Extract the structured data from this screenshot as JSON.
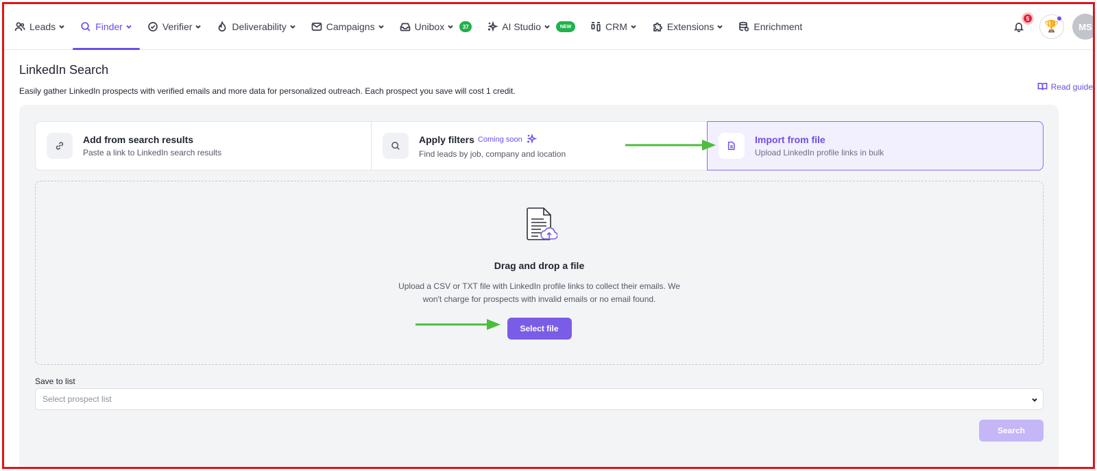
{
  "nav": {
    "items": [
      {
        "label": "Leads",
        "icon": "users-icon",
        "dropdown": true,
        "active": false
      },
      {
        "label": "Finder",
        "icon": "search-icon",
        "dropdown": true,
        "active": true
      },
      {
        "label": "Verifier",
        "icon": "check-circle-icon",
        "dropdown": true,
        "active": false
      },
      {
        "label": "Deliverability",
        "icon": "flame-icon",
        "dropdown": true,
        "active": false
      },
      {
        "label": "Campaigns",
        "icon": "mail-icon",
        "dropdown": true,
        "active": false
      },
      {
        "label": "Unibox",
        "icon": "inbox-icon",
        "dropdown": true,
        "active": false,
        "badge": "37"
      },
      {
        "label": "AI Studio",
        "icon": "sparkle-icon",
        "dropdown": true,
        "active": false,
        "badge": "NEW"
      },
      {
        "label": "CRM",
        "icon": "kanban-icon",
        "dropdown": true,
        "active": false
      },
      {
        "label": "Extensions",
        "icon": "puzzle-icon",
        "dropdown": true,
        "active": false
      },
      {
        "label": "Enrichment",
        "icon": "database-icon",
        "dropdown": false,
        "active": false
      }
    ],
    "notifications_count": "5",
    "avatar_initials": "MS",
    "accent_color": "#6d4de8",
    "badge_color": "#22b14c"
  },
  "header": {
    "title": "LinkedIn Search",
    "subtitle": "Easily gather LinkedIn prospects with verified emails and more data for personalized outreach. Each prospect you save will cost 1 credit.",
    "read_guide": "Read guide"
  },
  "methods": [
    {
      "title": "Add from search results",
      "desc": "Paste a link to LinkedIn search results",
      "icon": "link-icon"
    },
    {
      "title": "Apply filters",
      "tag": "Coming soon",
      "desc": "Find leads by job, company and location",
      "icon": "search-icon"
    },
    {
      "title": "Import from file",
      "desc": "Upload LinkedIn profile links in bulk",
      "icon": "file-icon",
      "selected": true
    }
  ],
  "dropzone": {
    "title": "Drag and drop a file",
    "desc": "Upload a CSV or TXT file with LinkedIn profile links to collect their emails. We won't charge for prospects with invalid emails or no email found.",
    "button": "Select file"
  },
  "save_to_list": {
    "label": "Save to list",
    "placeholder": "Select prospect list"
  },
  "search_button": "Search",
  "annotation_color": "#4cbd3c"
}
